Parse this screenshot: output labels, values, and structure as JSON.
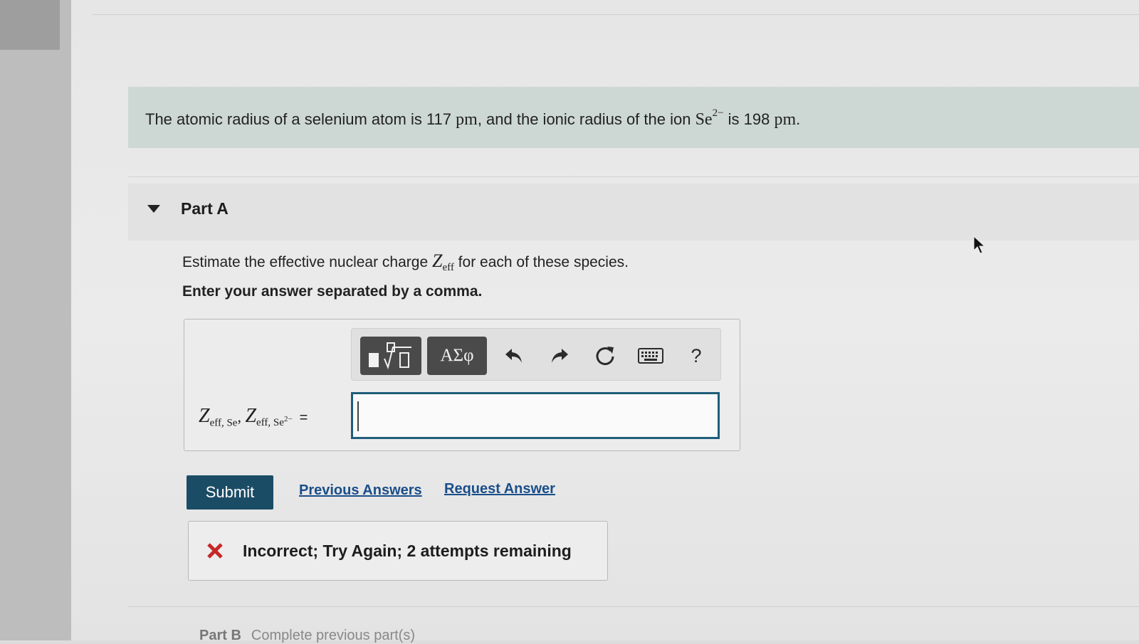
{
  "intro": {
    "text_before": "The atomic radius of a selenium atom is 117 ",
    "unit1": "pm",
    "text_middle": ", and the ionic radius of the ion ",
    "ion": "Se",
    "ion_charge": "2−",
    "text_after": " is 198 ",
    "unit2": "pm",
    "period": "."
  },
  "part": {
    "title": "Part A",
    "question_before": "Estimate the effective nuclear charge ",
    "zeff_symbol": "Z",
    "zeff_sub": "eff",
    "question_after": " for each of these species.",
    "instruction": "Enter your answer separated by a comma."
  },
  "toolbar": {
    "templates_icon": "templates-radical-icon",
    "greek_label": "ΑΣφ",
    "undo_icon": "undo-icon",
    "redo_icon": "redo-icon",
    "reset_icon": "reset-icon",
    "keyboard_icon": "keyboard-icon",
    "help_label": "?"
  },
  "answer": {
    "label_z1": "Z",
    "label_sub1": "eff, Se",
    "comma": ", ",
    "label_z2": "Z",
    "label_sub2": "eff, Se",
    "label_sub2_charge": "2−",
    "equals": "=",
    "value": ""
  },
  "actions": {
    "submit_label": "Submit",
    "previous_answers_label": "Previous Answers",
    "request_answer_label": "Request Answer"
  },
  "feedback": {
    "icon": "x-icon",
    "message": "Incorrect; Try Again; 2 attempts remaining",
    "icon_color": "#c62828"
  },
  "next_part": {
    "label": "Part B",
    "status": "Complete previous part(s)"
  },
  "colors": {
    "intro_background": "#cdd8d5",
    "submit_background": "#1b4c66",
    "link": "#1a4e8a",
    "input_border": "#1f5d7a"
  }
}
